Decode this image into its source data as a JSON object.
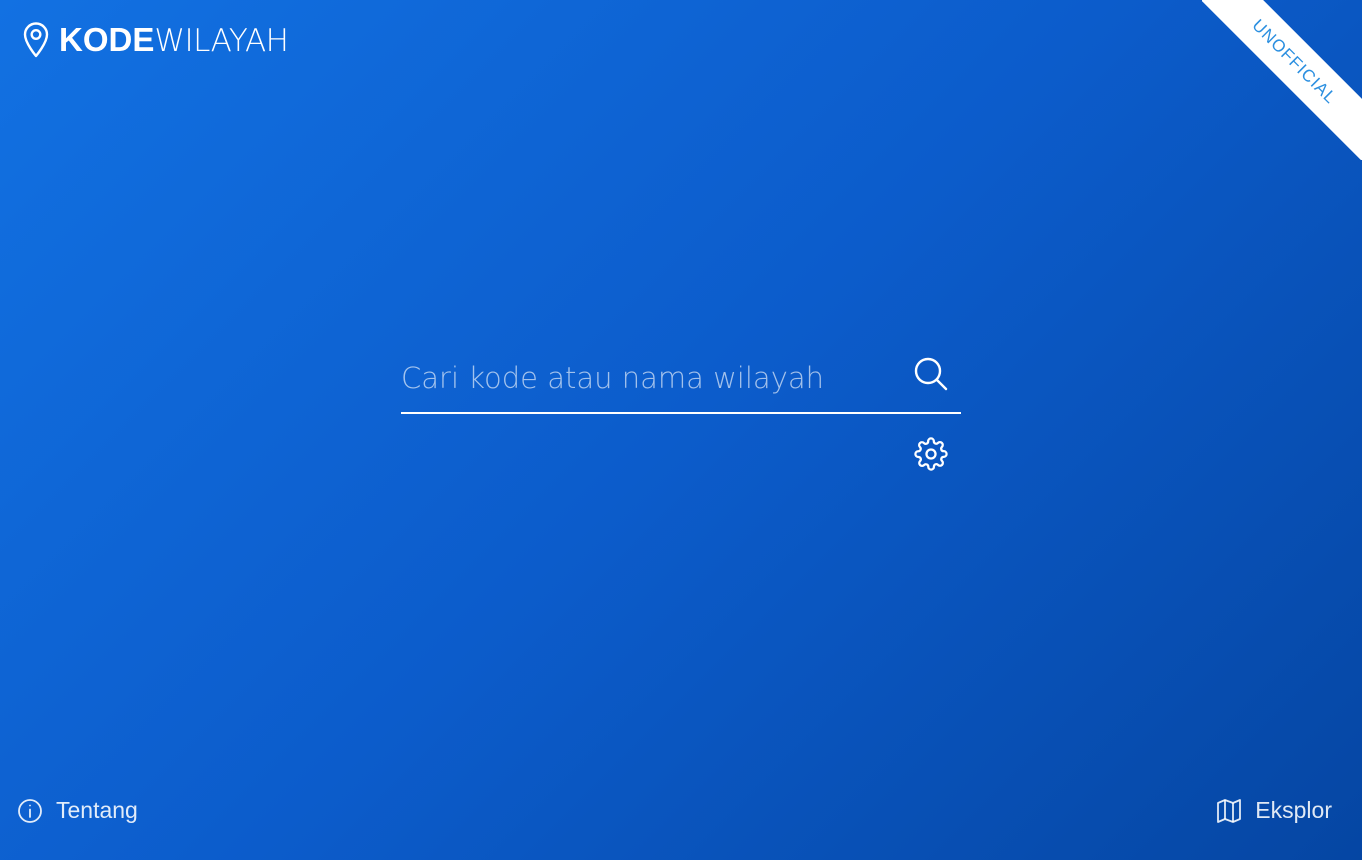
{
  "header": {
    "logo_bold": "KODE",
    "logo_light": "WILAYAH",
    "logo_icon": "map-pin-icon"
  },
  "ribbon": {
    "label": "UNOFFICIAL"
  },
  "search": {
    "placeholder": "Cari kode atau nama wilayah",
    "value": "",
    "search_icon": "search-icon",
    "settings_icon": "gear-icon"
  },
  "footer": {
    "about_label": "Tentang",
    "about_icon": "info-icon",
    "explore_label": "Eksplor",
    "explore_icon": "map-icon"
  },
  "colors": {
    "background_start": "#1271e2",
    "background_end": "#0546a3",
    "ribbon_bg": "#ffffff",
    "ribbon_text": "#2b8fe0",
    "foreground": "#ffffff"
  }
}
